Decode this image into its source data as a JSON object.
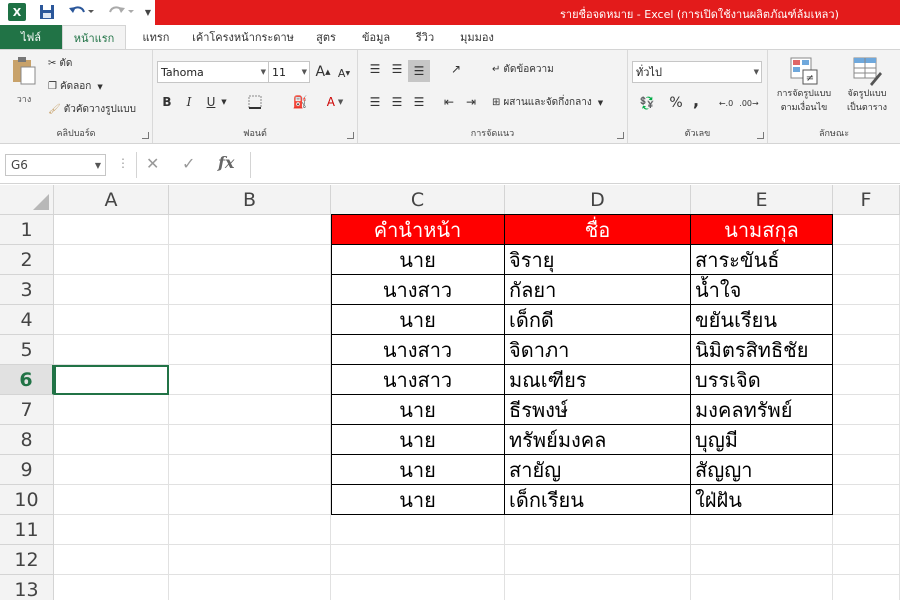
{
  "titlebar": {
    "title": "รายชื่อจดหมาย - Excel (การเปิดใช้งานผลิตภัณฑ์ล้มเหลว)",
    "app_icon_letter": "X",
    "accent": "#217346",
    "title_bg": "#e31b1b"
  },
  "tabs": [
    {
      "label": "ไฟล์"
    },
    {
      "label": "หน้าแรก"
    },
    {
      "label": "แทรก"
    },
    {
      "label": "เค้าโครงหน้ากระดาษ"
    },
    {
      "label": "สูตร"
    },
    {
      "label": "ข้อมูล"
    },
    {
      "label": "รีวิว"
    },
    {
      "label": "มุมมอง"
    }
  ],
  "ribbon": {
    "clipboard": {
      "label": "คลิปบอร์ด",
      "paste": "วาง",
      "cut": "ตัด",
      "copy": "คัดลอก",
      "format_painter": "ตัวคัดวางรูปแบบ"
    },
    "font": {
      "label": "ฟอนต์",
      "font_name": "Tahoma",
      "font_size": "11",
      "grow": "A",
      "shrink": "A",
      "bold": "B",
      "italic": "I",
      "underline": "U",
      "font_color": "A"
    },
    "alignment": {
      "label": "การจัดแนว",
      "wrap_text": "ตัดข้อความ",
      "merge_center": "ผสานและจัดกึ่งกลาง"
    },
    "number": {
      "label": "ตัวเลข",
      "format": "ทั่วไป",
      "percent": "%",
      "comma": ","
    },
    "styles": {
      "label": "ลักษณะ",
      "conditional": "การจัดรูปแบบ",
      "conditional2": "ตามเงื่อนไข",
      "as_table": "จัดรูปแบบ",
      "as_table2": "เป็นตาราง"
    }
  },
  "formula_bar": {
    "name_box": "G6",
    "fx": "fx",
    "value": ""
  },
  "sheet": {
    "columns": [
      "A",
      "B",
      "C",
      "D",
      "E",
      "F"
    ],
    "rows": [
      "1",
      "2",
      "3",
      "4",
      "5",
      "6",
      "7",
      "8",
      "9",
      "10",
      "11",
      "12",
      "13"
    ],
    "active_row": "6",
    "header_bg": "#ff0000",
    "table_headers": [
      "คำนำหน้า",
      "ชื่อ",
      "นามสกุล"
    ],
    "table_rows": [
      [
        "นาย",
        "จิรายุ",
        "สาระขันธ์"
      ],
      [
        "นางสาว",
        "กัลยา",
        "น้ำใจ"
      ],
      [
        "นาย",
        "เด็กดี",
        "ขยันเรียน"
      ],
      [
        "นางสาว",
        "จิดาภา",
        "นิมิตรสิทธิชัย"
      ],
      [
        "นางสาว",
        "มณเฑียร",
        "บรรเจิด"
      ],
      [
        "นาย",
        "ธีรพงษ์",
        "มงคลทรัพย์"
      ],
      [
        "นาย",
        "ทรัพย์มงคล",
        "บุญมี"
      ],
      [
        "นาย",
        "สายัญ",
        "สัญญา"
      ],
      [
        "นาย",
        "เด็กเรียน",
        "ใฝ่ฝัน"
      ]
    ]
  }
}
